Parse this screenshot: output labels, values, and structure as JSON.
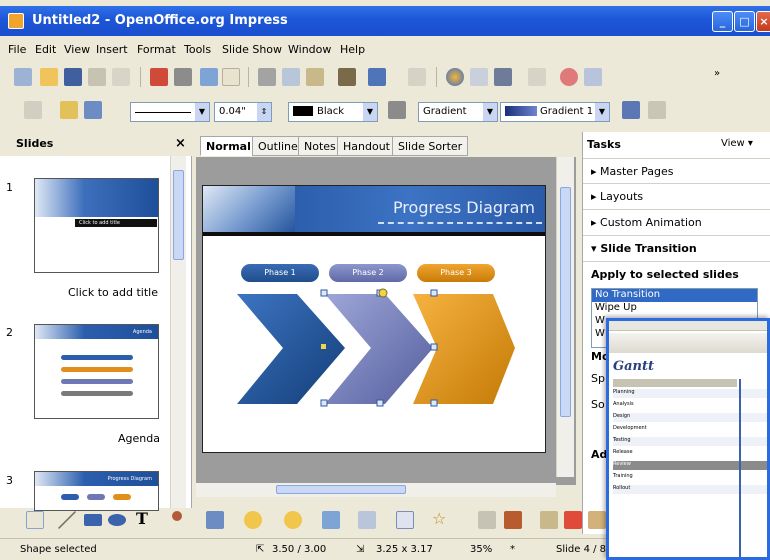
{
  "window": {
    "title": "Untitled2 - OpenOffice.org Impress",
    "app_icon": "impress-icon"
  },
  "menu": [
    "File",
    "Edit",
    "View",
    "Insert",
    "Format",
    "Tools",
    "Slide Show",
    "Window",
    "Help"
  ],
  "line_toolbar": {
    "line_width": "0.04\"",
    "line_color": "Black",
    "area_style": "Gradient",
    "area_fill": "Gradient 1"
  },
  "slides_panel": {
    "title": "Slides",
    "close": "×",
    "slides": [
      {
        "number": "1",
        "caption": "Click to add title",
        "thumb_text": "Click to add title"
      },
      {
        "number": "2",
        "caption": "Agenda",
        "thumb_text": "Agenda"
      },
      {
        "number": "3",
        "caption": "",
        "thumb_text": "Progress Diagram"
      }
    ]
  },
  "view_tabs": [
    "Normal",
    "Outline",
    "Notes",
    "Handout",
    "Slide Sorter"
  ],
  "slide": {
    "title": "Progress Diagram",
    "phases": [
      "Phase 1",
      "Phase 2",
      "Phase 3"
    ],
    "colors": {
      "phase1": "#1f4e8c",
      "phase2": "#6e78b4",
      "phase3": "#d9900f",
      "banner": "#2b5fae"
    }
  },
  "tasks_panel": {
    "title": "Tasks",
    "view_label": "View",
    "sections": [
      "Master Pages",
      "Layouts",
      "Custom Animation",
      "Slide Transition"
    ],
    "apply_label": "Apply to selected slides",
    "transitions": [
      "No Transition",
      "Wipe Up",
      "W",
      "W"
    ],
    "partial_labels": [
      "Mo",
      "Sp",
      "So",
      "Ad"
    ]
  },
  "status": {
    "selection": "Shape selected",
    "position": "3.50 / 3.00",
    "size": "3.25 x 3.17",
    "zoom": "35%",
    "page": "Slide 4 / 8"
  },
  "gantt_popup": {
    "title": "Gantt",
    "rows": [
      "Planning",
      "Analysis",
      "Design",
      "Development",
      "Testing",
      "Release",
      "Review",
      "Training",
      "Rollout"
    ]
  }
}
